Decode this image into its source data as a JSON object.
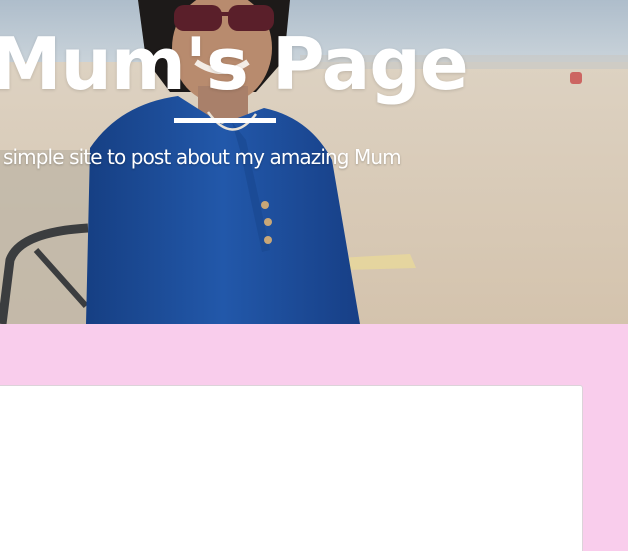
{
  "header": {
    "title": "Mum's Page",
    "subtitle": "simple site to post about my amazing Mum"
  },
  "colors": {
    "page_background": "#f9cdec",
    "card_background": "#ffffff",
    "title_text": "#ffffff",
    "shirt_blue": "#1c4f9c"
  },
  "icons": {
    "hero_image": "beach-portrait-photo"
  }
}
